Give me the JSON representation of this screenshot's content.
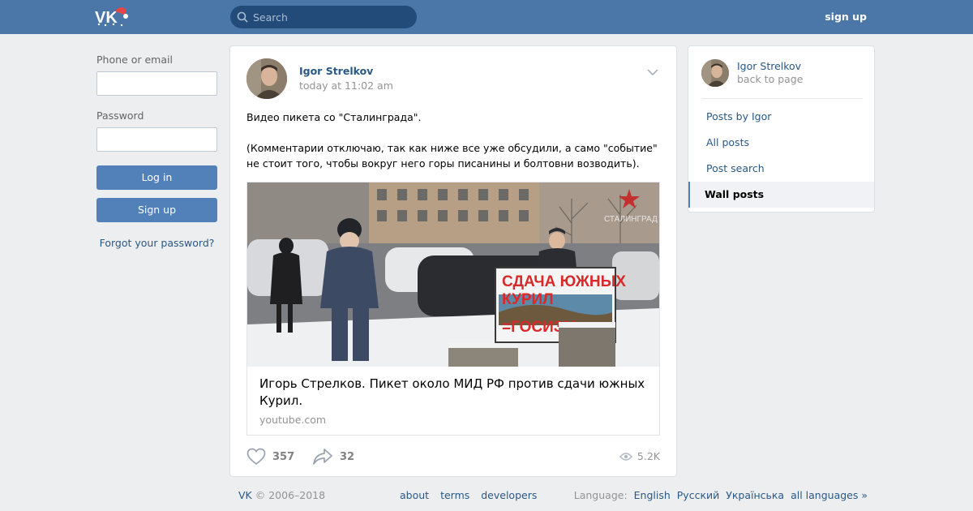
{
  "header": {
    "search_placeholder": "Search",
    "signup_label": "sign up"
  },
  "login": {
    "phone_label": "Phone or email",
    "password_label": "Password",
    "login_button": "Log in",
    "signup_button": "Sign up",
    "forgot_link": "Forgot your password?"
  },
  "post": {
    "author": "Igor Strelkov",
    "time": "today at 11:02 am",
    "text_1": "Видео пикета со \"Сталинграда\".",
    "text_2": "(Комментарии отключаю, так как ниже все уже обсудили, а само \"событие\" не стоит того, чтобы вокруг него горы писанины и болтовни возводить).",
    "attachment": {
      "title": "Игорь Стрелков. Пикет около МИД РФ против сдачи южных Курил.",
      "source": "youtube.com",
      "sign_line_1": "СДАЧА ЮЖНЫХ",
      "sign_line_2": "КУРИЛ",
      "sign_line_3": "=ГОСИЗМ",
      "watermark": "СТАЛИНГРАД"
    },
    "likes": "357",
    "shares": "32",
    "views": "5.2K"
  },
  "side": {
    "name": "Igor Strelkov",
    "back": "back to page",
    "menu": [
      {
        "label": "Posts by Igor"
      },
      {
        "label": "All posts"
      },
      {
        "label": "Post search"
      },
      {
        "label": "Wall posts"
      }
    ]
  },
  "footer": {
    "brand": "VK",
    "copyright": "© 2006–2018",
    "links": [
      "about",
      "terms",
      "developers"
    ],
    "language_label": "Language:",
    "languages": [
      "English",
      "Русский",
      "Українська",
      "all languages »"
    ]
  },
  "colors": {
    "header": "#4a76a8",
    "link": "#2a5885",
    "button": "#5181b8",
    "background": "#edeef0"
  }
}
